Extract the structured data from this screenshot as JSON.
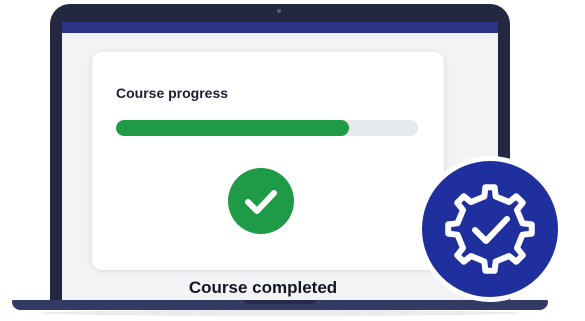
{
  "course": {
    "title": "Course progress",
    "progress": 0.77,
    "status": "Course completed"
  },
  "icons": {
    "completion": "checkmark-circle-icon",
    "badge": "gear-check-badge-icon"
  },
  "colors": {
    "accent_green": "#1f9a46",
    "brand_blue": "#1f2f9e",
    "topbar": "#2b3486"
  }
}
